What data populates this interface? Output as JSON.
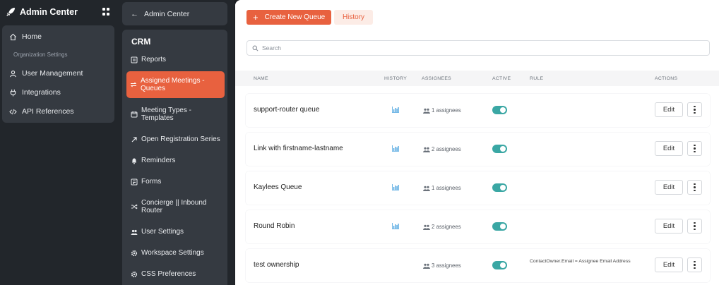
{
  "app": {
    "title": "Admin Center",
    "apps_icon": "apps-grid-icon",
    "logo_icon": "rocket-logo-icon"
  },
  "rail": {
    "home_label": "Home",
    "section_label": "Organization Settings",
    "items": [
      {
        "label": "User Management",
        "icon": "user-icon"
      },
      {
        "label": "Integrations",
        "icon": "plug-icon"
      },
      {
        "label": "API References",
        "icon": "code-icon"
      }
    ]
  },
  "sidebar": {
    "back_label": "Admin Center",
    "heading": "CRM",
    "items": [
      {
        "label": "Reports",
        "icon": "report-icon"
      },
      {
        "label": "Assigned Meetings - Queues",
        "icon": "swap-arrows-icon",
        "active": true
      },
      {
        "label": "Meeting Types - Templates",
        "icon": "calendar-icon"
      },
      {
        "label": "Open Registration Series",
        "icon": "arrow-up-right-icon"
      },
      {
        "label": "Reminders",
        "icon": "bell-icon"
      },
      {
        "label": "Forms",
        "icon": "form-icon"
      },
      {
        "label": "Concierge || Inbound Router",
        "icon": "shuffle-icon"
      },
      {
        "label": "User Settings",
        "icon": "users-icon"
      },
      {
        "label": "Workspace Settings",
        "icon": "gear-icon"
      },
      {
        "label": "CSS Preferences",
        "icon": "gear-icon"
      }
    ]
  },
  "toolbar": {
    "create_label": "Create New Queue",
    "history_label": "History"
  },
  "search": {
    "placeholder": "Search",
    "value": ""
  },
  "table": {
    "headers": {
      "name": "NAME",
      "history": "HISTORY",
      "assignees": "ASSIGNEES",
      "active": "ACTIVE",
      "rule": "RULE",
      "actions": "ACTIONS"
    },
    "edit_label": "Edit",
    "rows": [
      {
        "name": "support-router queue",
        "has_history": true,
        "assignees": "1 assignees",
        "active": true,
        "rule": ""
      },
      {
        "name": "Link with firstname-lastname",
        "has_history": true,
        "assignees": "2 assignees",
        "active": true,
        "rule": ""
      },
      {
        "name": "Kaylees Queue",
        "has_history": true,
        "assignees": "1 assignees",
        "active": true,
        "rule": ""
      },
      {
        "name": "Round Robin",
        "has_history": true,
        "assignees": "2 assignees",
        "active": true,
        "rule": ""
      },
      {
        "name": "test ownership",
        "has_history": false,
        "assignees": "3 assignees",
        "active": true,
        "rule": "ContactOwner.Email = Assignee Email Address"
      }
    ]
  },
  "colors": {
    "accent": "#e8613f",
    "toggle_on": "#3aa7a4",
    "chart_icon": "#4aa3df"
  }
}
